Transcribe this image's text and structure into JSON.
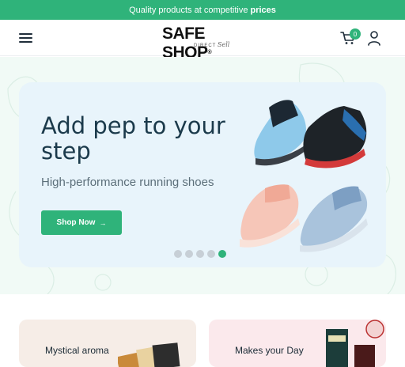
{
  "announcement": {
    "text": "Quality products at competitive",
    "highlight": "prices"
  },
  "header": {
    "logo_main": "SAFE SHOP",
    "logo_reg": "®",
    "logo_sub": "DIRECT",
    "logo_sub_script": "Sell",
    "cart_count": "0"
  },
  "hero": {
    "title": "Add pep to your step",
    "subtitle": "High-performance running shoes",
    "button_label": "Shop Now",
    "button_arrow": "→",
    "slides_total": 5,
    "active_slide": 5
  },
  "promos": [
    {
      "label": "Mystical aroma"
    },
    {
      "label": "Makes your Day"
    }
  ],
  "colors": {
    "brand_green": "#2fb37a",
    "hero_bg": "#e8f4fb",
    "dot_inactive": "#c7cfd6"
  }
}
